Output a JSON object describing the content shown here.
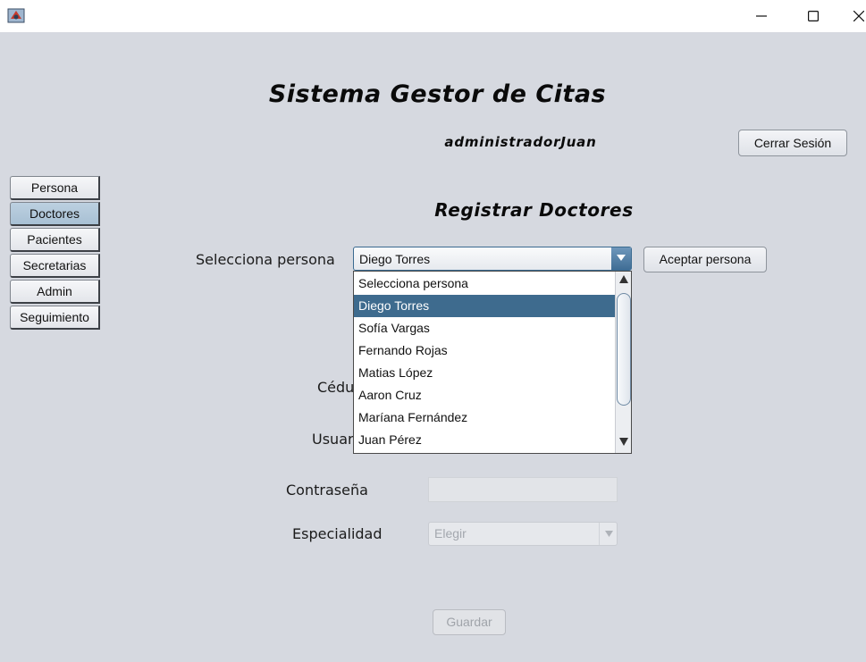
{
  "window": {
    "icons": [
      "app-icon",
      "minimize-icon",
      "maximize-icon",
      "close-icon"
    ]
  },
  "header": {
    "title": "Sistema Gestor de Citas",
    "user": "administradorJuan",
    "logout_label": "Cerrar Sesión"
  },
  "sidebar": {
    "items": [
      {
        "label": "Persona"
      },
      {
        "label": "Doctores"
      },
      {
        "label": "Pacientes"
      },
      {
        "label": "Secretarias"
      },
      {
        "label": "Admin"
      },
      {
        "label": "Seguimiento"
      }
    ],
    "active": "Doctores"
  },
  "form": {
    "section_title": "Registrar Doctores",
    "select_person_label": "Selecciona persona",
    "person_combo": {
      "selected": "Diego Torres",
      "options": [
        "Selecciona persona",
        "Diego Torres",
        "Sofía Vargas",
        "Fernando Rojas",
        "Matias López",
        "Aaron Cruz",
        "Maríana Fernández",
        "Juan Pérez"
      ]
    },
    "accept_person_label": "Aceptar persona",
    "cedula_label_visible": "Cédu",
    "usuario_label_visible": "Usuar",
    "password_label": "Contraseña",
    "password_value": "",
    "specialty_label": "Especialidad",
    "specialty_value": "Elegir",
    "save_label": "Guardar"
  },
  "colors": {
    "background": "#d6d9e0",
    "selection": "#3e6b8e",
    "sidebar_active": "#bcd0e0"
  }
}
